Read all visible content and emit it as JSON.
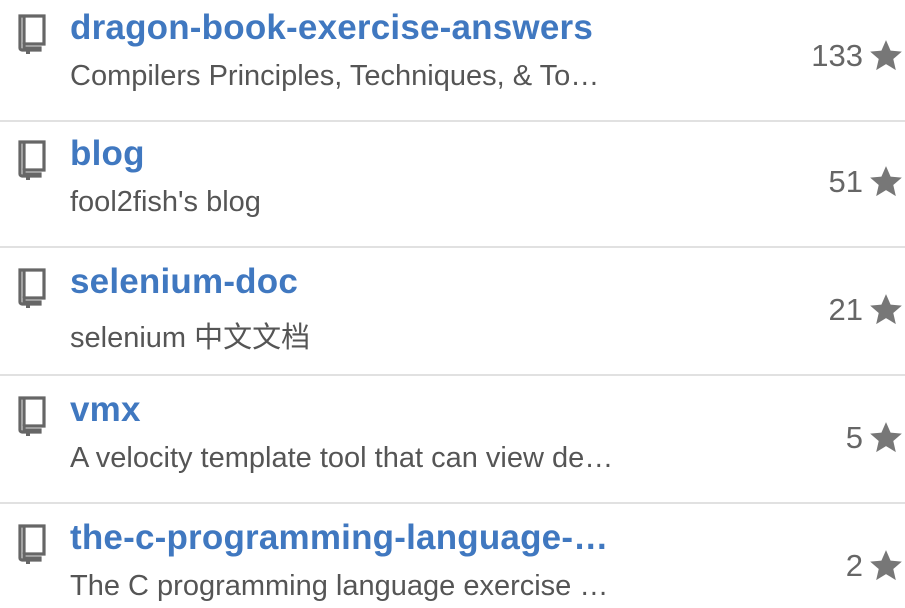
{
  "repos": [
    {
      "name": "dragon-book-exercise-answers",
      "description": "Compilers Principles, Techniques, & To…",
      "stars": "133",
      "icon": "repo-book-icon"
    },
    {
      "name": "blog",
      "description": "fool2fish's blog",
      "stars": "51",
      "icon": "repo-book-icon"
    },
    {
      "name": "selenium-doc",
      "description": "selenium 中文文档",
      "stars": "21",
      "icon": "repo-book-icon"
    },
    {
      "name": "vmx",
      "description": "A velocity template tool that can view de…",
      "stars": "5",
      "icon": "repo-book-icon"
    },
    {
      "name": "the-c-programming-language-…",
      "description": "The C programming language exercise …",
      "stars": "2",
      "icon": "repo-book-icon"
    }
  ],
  "colors": {
    "link": "#4078c0",
    "description": "#555555",
    "star": "#666666",
    "divider": "#e1e1e1"
  }
}
